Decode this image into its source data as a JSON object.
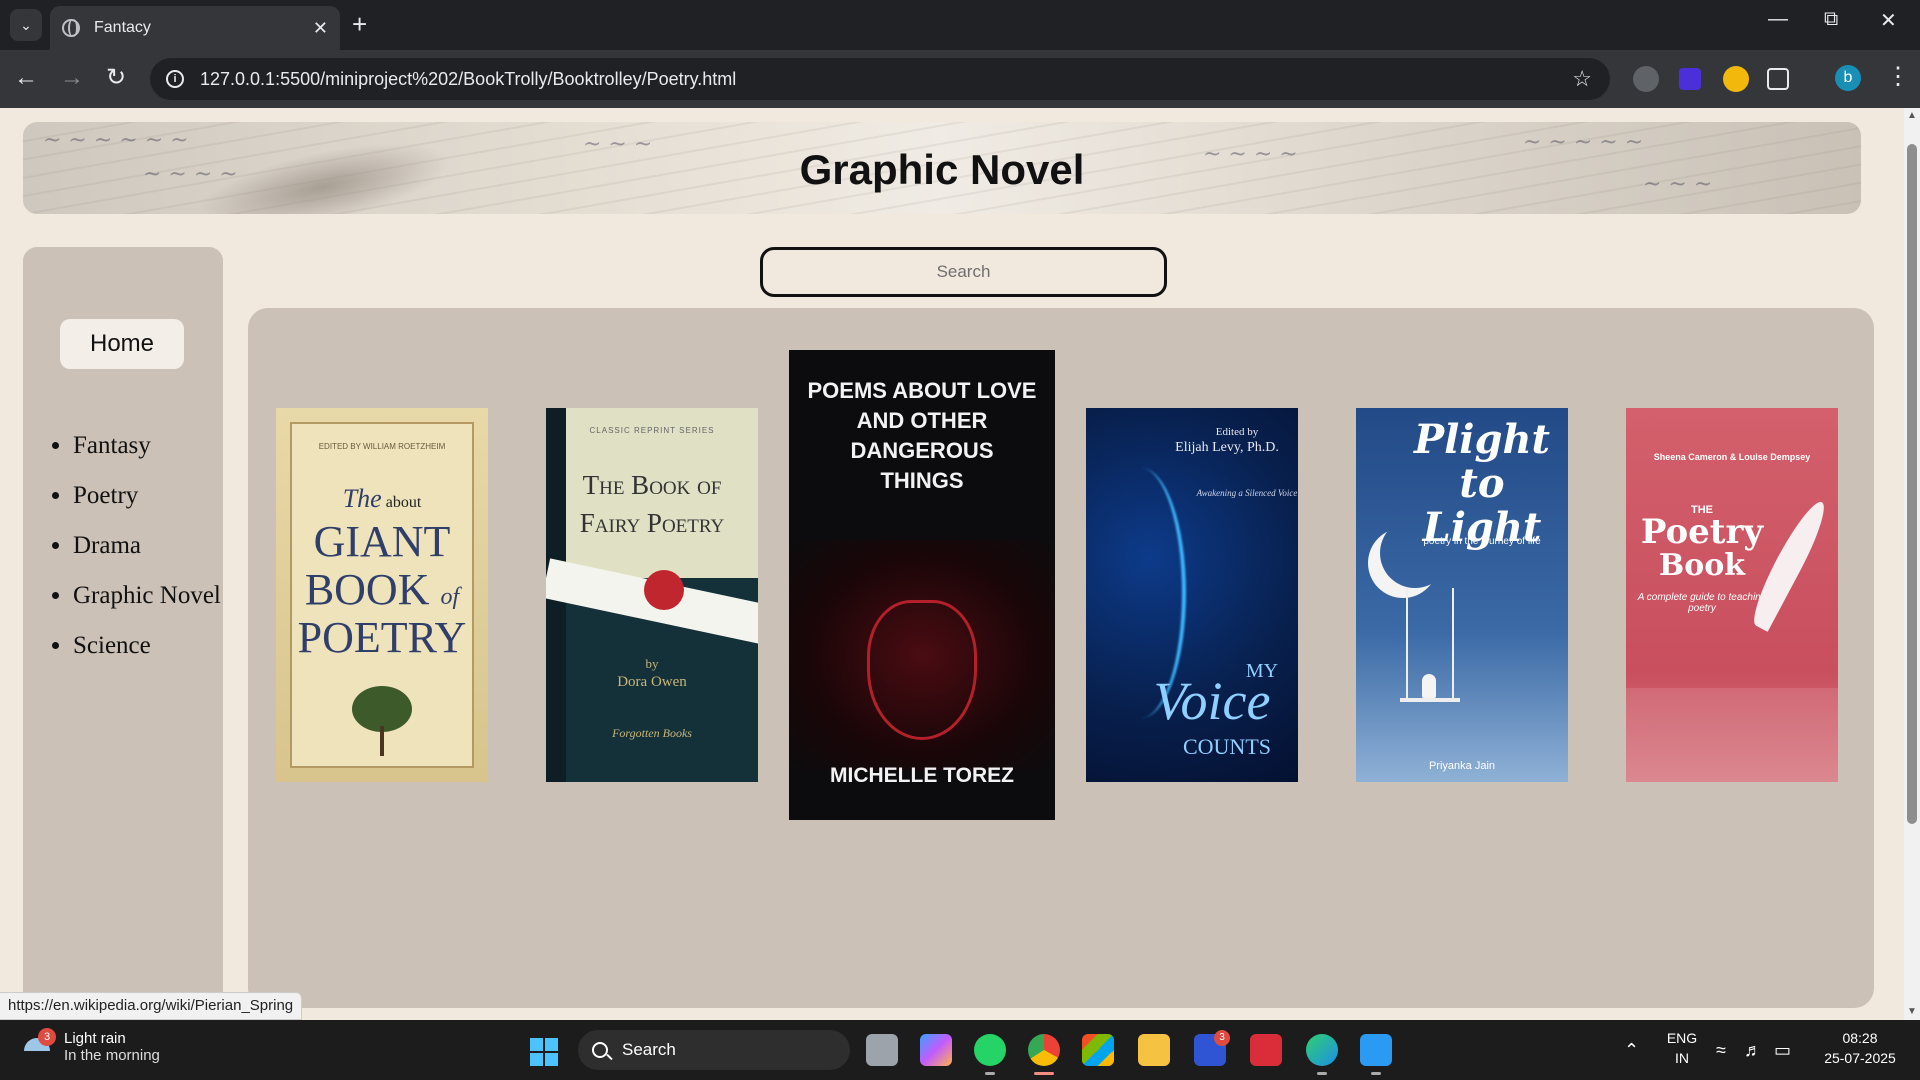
{
  "browser": {
    "tab_title": "Fantacy",
    "url": "127.0.0.1:5500/miniproject%202/BookTrolly/Booktrolley/Poetry.html",
    "profile_initial": "b"
  },
  "page": {
    "banner_title": "Graphic Novel",
    "search_placeholder": "Search",
    "home_label": "Home",
    "genres": [
      "Fantasy",
      "Poetry",
      "Drama",
      "Graphic Novel",
      "Science"
    ],
    "books": [
      {
        "editor": "EDITED BY WILLIAM ROETZHEIM",
        "title_a": "The",
        "title_b": "about",
        "title_c": "GIANT",
        "title_d": "BOOK",
        "title_e": "of",
        "title_f": "POETRY"
      },
      {
        "series": "CLASSIC REPRINT SERIES",
        "title": "The Book of Fairy Poetry",
        "by": "by",
        "author": "Dora Owen",
        "publisher": "Forgotten Books"
      },
      {
        "title": "POEMS ABOUT LOVE AND OTHER DANGEROUS THINGS",
        "author": "MICHELLE TOREZ"
      },
      {
        "editor_line1": "Edited by",
        "editor_line2": "Elijah Levy, Ph.D.",
        "tagline": "Awakening a Silenced Voice",
        "title_a": "MY",
        "title_b": "Voice",
        "title_c": "COUNTS"
      },
      {
        "title": "Plight to Light",
        "subtitle": "poetry in the journey of life",
        "author": "Priyanka Jain"
      },
      {
        "authors": "Sheena Cameron & Louise Dempsey",
        "title_a": "THE",
        "title_b": "Poetry",
        "title_c": "Book",
        "subtitle": "A complete guide to teaching poetry"
      }
    ]
  },
  "status_url": "https://en.wikipedia.org/wiki/Pierian_Spring",
  "taskbar": {
    "weather_title": "Light rain",
    "weather_sub": "In the morning",
    "weather_badge": "3",
    "search_label": "Search",
    "app_badge": "3",
    "lang_top": "ENG",
    "lang_bottom": "IN",
    "time": "08:28",
    "date": "25-07-2025"
  }
}
